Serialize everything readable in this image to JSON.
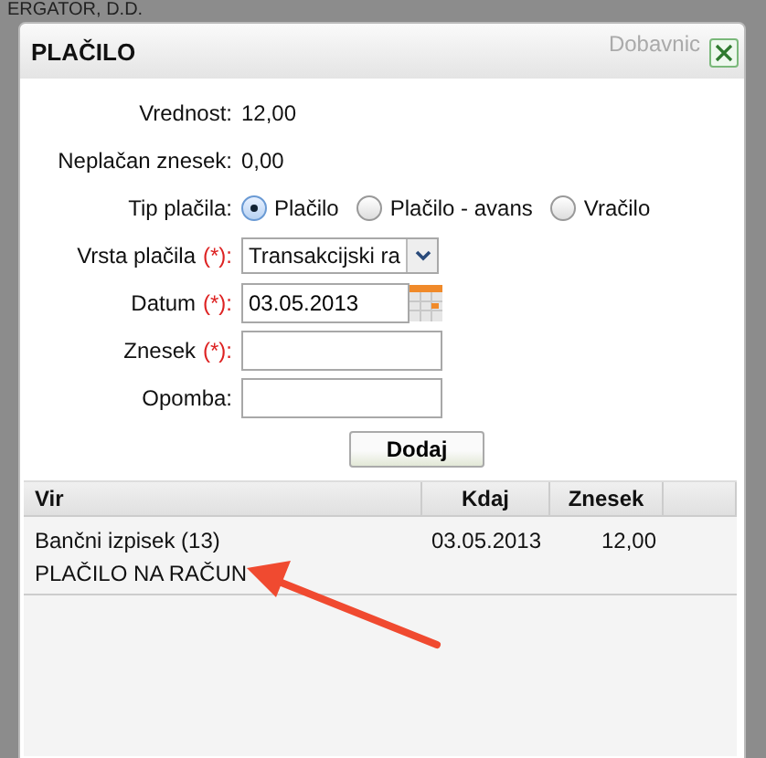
{
  "backdrop": {
    "text": "ERGATOR, D.D.",
    "behind_title": "Dobavnic"
  },
  "dialog": {
    "title": "PLAČILO"
  },
  "info": [
    {
      "label": "Vrednost:",
      "value": "12,00"
    },
    {
      "label": "Neplačan znesek:",
      "value": "0,00"
    }
  ],
  "payment_type": {
    "label": "Tip plačila:",
    "options": [
      {
        "label": "Plačilo",
        "selected": true
      },
      {
        "label": "Plačilo - avans",
        "selected": false
      },
      {
        "label": "Vračilo",
        "selected": false
      }
    ]
  },
  "fields": [
    {
      "kind": "select",
      "label": "Vrsta plačila",
      "required": "(*):",
      "value": "Transakcijski ra"
    },
    {
      "kind": "date",
      "label": "Datum",
      "required": "(*):",
      "value": "03.05.2013"
    },
    {
      "kind": "text",
      "label": "Znesek",
      "required": "(*):"
    },
    {
      "kind": "text",
      "label": "Opomba:"
    }
  ],
  "add_button": "Dodaj",
  "table": {
    "columns": [
      "Vir",
      "Kdaj",
      "Znesek"
    ],
    "rows": [
      {
        "source": "Bančni izpisek (13)",
        "note": "PLAČILO NA RAČUN",
        "date": "03.05.2013",
        "amount": "12,00"
      }
    ]
  }
}
